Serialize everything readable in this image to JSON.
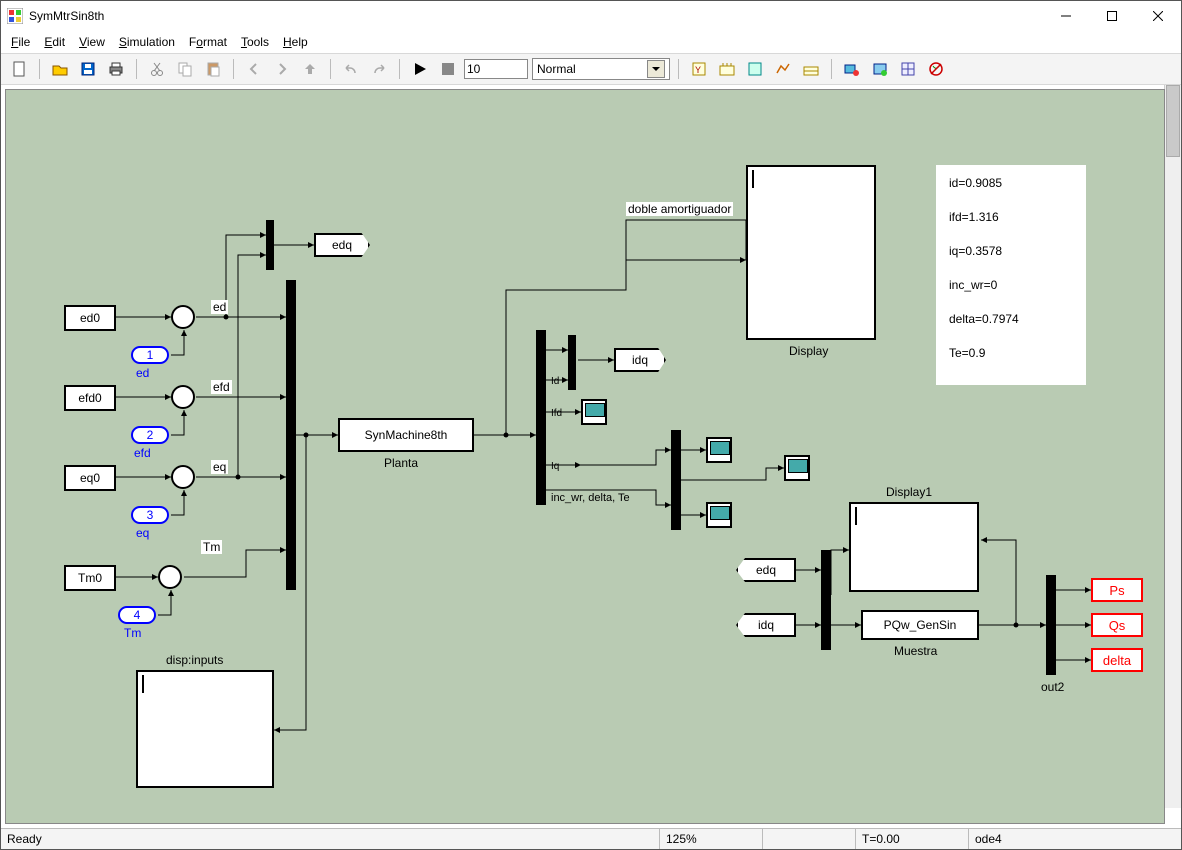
{
  "window": {
    "title": "SymMtrSin8th"
  },
  "menus": {
    "file": "File",
    "edit": "Edit",
    "view": "View",
    "simulation": "Simulation",
    "format": "Format",
    "tools": "Tools",
    "help": "Help"
  },
  "toolbar": {
    "stop_time": "10",
    "mode_selected": "Normal"
  },
  "annotations": {
    "doble_amortiguador": "doble amortiguador",
    "disp_inputs": "disp:inputs",
    "inc_wr_delta_te": "inc_wr, delta, Te",
    "Id": "Id",
    "Ifd": "Ifd",
    "Iq": "Iq"
  },
  "blocks": {
    "ed0": "ed0",
    "efd0": "efd0",
    "eq0": "eq0",
    "Tm0": "Tm0",
    "ed_sig": "ed",
    "efd_sig": "efd",
    "eq_sig": "eq",
    "Tm_sig": "Tm",
    "in1": "1",
    "in1_lbl": "ed",
    "in2": "2",
    "in2_lbl": "efd",
    "in3": "3",
    "in3_lbl": "eq",
    "in4": "4",
    "in4_lbl": "Tm",
    "edq": "edq",
    "idq": "idq",
    "synmachine": "SynMachine8th",
    "planta": "Planta",
    "display": "Display",
    "display1": "Display1",
    "pqw": "PQw_GenSin",
    "muestra": "Muestra",
    "from_edq": "edq",
    "from_idq": "idq",
    "ps": "Ps",
    "qs": "Qs",
    "delta": "delta",
    "out2": "out2"
  },
  "readout": {
    "l1": "id=0.9085",
    "l2": "ifd=1.316",
    "l3": "iq=0.3578",
    "l4": "inc_wr=0",
    "l5": "delta=0.7974",
    "l6": "Te=0.9"
  },
  "status": {
    "ready": "Ready",
    "zoom": "125%",
    "t": "T=0.00",
    "solver": "ode4"
  }
}
